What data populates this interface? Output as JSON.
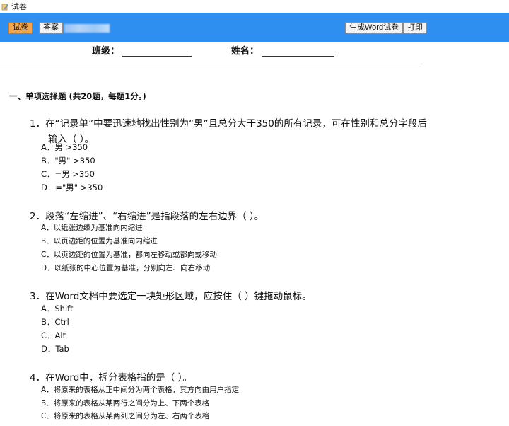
{
  "window": {
    "title": "试卷"
  },
  "toolbar": {
    "exam_label": "试卷",
    "answer_label": "答案",
    "word_label": "生成Word试卷",
    "print_label": "打印"
  },
  "fields": {
    "class_label": "班级：",
    "name_label": "姓名："
  },
  "section": {
    "title": "一、单项选择题 (共20题，每题1分。)"
  },
  "questions": [
    {
      "number": "1．",
      "text": "在“记录单”中要迅速地找出性别为“男”且总分大于350的所有记录，可在性别和总分字段后",
      "text_cont": "输入（ ）。",
      "options": [
        "A．男 >350",
        "B．\"男\" >350",
        "C．=男 >350",
        "D．=\"男\" >350"
      ]
    },
    {
      "number": "2．",
      "text": "段落“左缩进”、“右缩进”是指段落的左右边界（ ）。",
      "options": [
        "A．以纸张边缘为基准向内缩进",
        "B．以页边距的位置为基准向内缩进",
        "C．以页边距的位置为基准，都向左移动或都向或移动",
        "D．以纸张的中心位置为基准，分别向左、向右移动"
      ]
    },
    {
      "number": "3．",
      "text": "在Word文档中要选定一块矩形区域，应按住（ ）键拖动鼠标。",
      "options": [
        "A．Shift",
        "B．Ctrl",
        "C．Alt",
        "D．Tab"
      ]
    },
    {
      "number": "4．",
      "text": "在Word中，拆分表格指的是（ ）。",
      "options": [
        "A．将原来的表格从正中间分为两个表格，其方向由用户指定",
        "B．将原来的表格从某两行之间分为上、下两个表格",
        "C．将原来的表格从某两列之间分为左、右两个表格"
      ]
    }
  ]
}
